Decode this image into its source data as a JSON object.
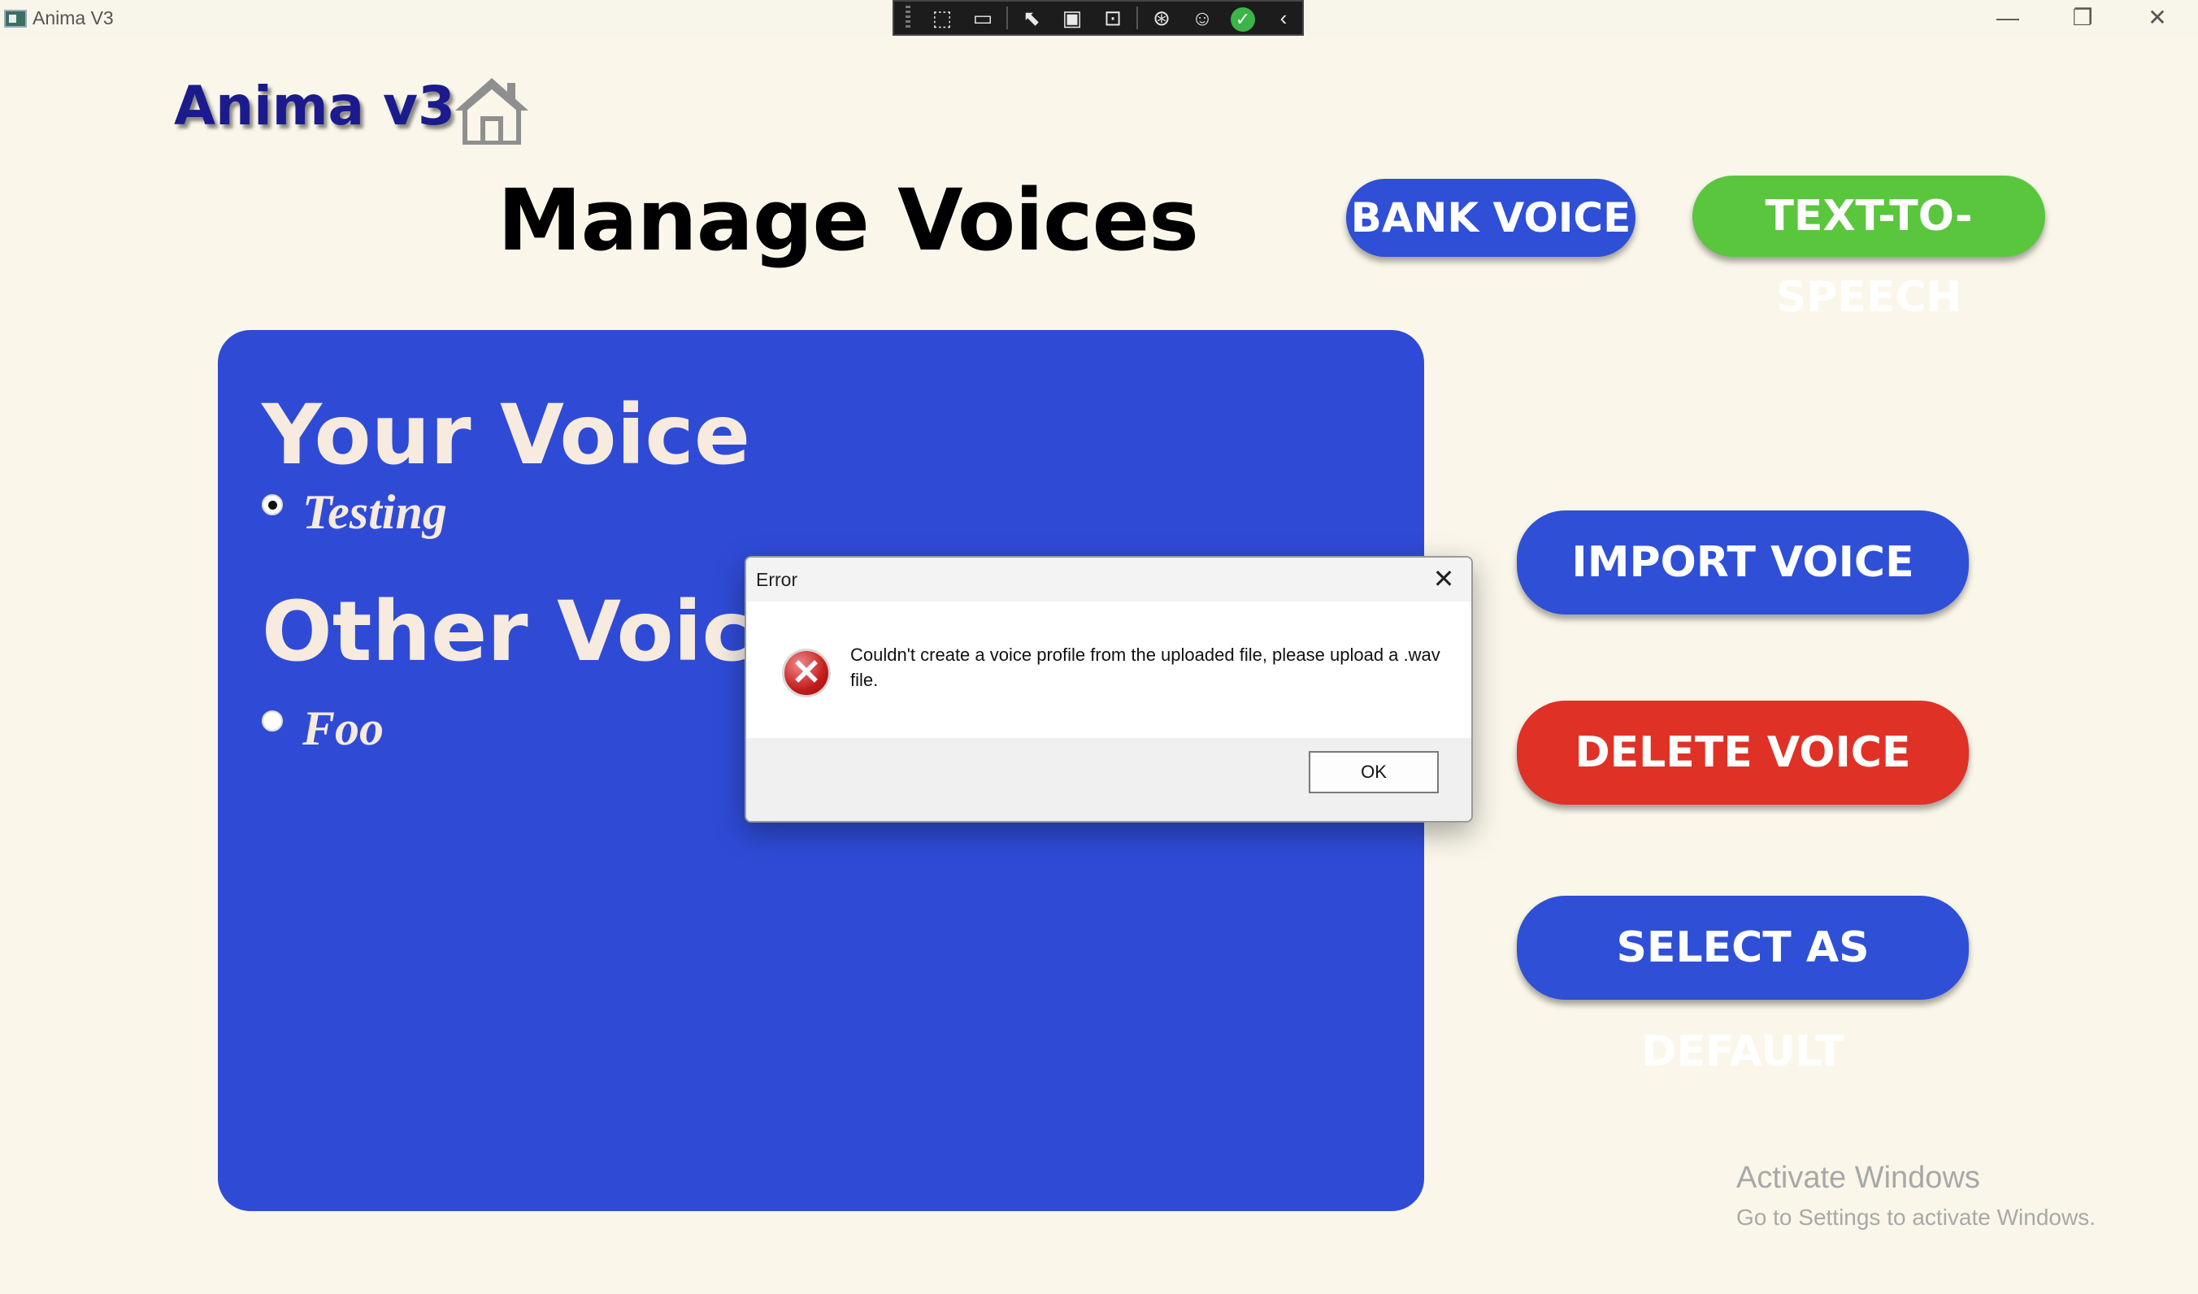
{
  "window": {
    "title": "Anima V3",
    "minimize": "—",
    "maximize": "❐",
    "close": "✕"
  },
  "devbar": {
    "icons": [
      "select-element-icon",
      "camera-icon",
      "pointer-icon",
      "frame-icon",
      "display-layout-icon",
      "track-focus-icon",
      "accessibility-icon",
      "check-icon",
      "collapse-icon"
    ]
  },
  "app": {
    "logo": "Anima v3",
    "page_title": "Manage Voices",
    "buttons": {
      "bank_voice": "BANK VOICE",
      "text_to_speech": "TEXT-TO-SPEECH",
      "import_voice": "IMPORT VOICE",
      "delete_voice": "DELETE VOICE",
      "select_default": "SELECT AS DEFAULT"
    },
    "colors": {
      "primary": "#2f4fd6",
      "green": "#5ac63d",
      "red": "#e03126",
      "background": "#faf7ea"
    }
  },
  "voices": {
    "your_voice_heading": "Your Voice",
    "your_voice": [
      {
        "name": "Testing",
        "selected": true
      }
    ],
    "other_voices_heading": "Other Voices",
    "other_voices": [
      {
        "name": "Foo",
        "selected": false
      }
    ]
  },
  "watermark": {
    "line1": "Activate Windows",
    "line2": "Go to Settings to activate Windows."
  },
  "dialog": {
    "title": "Error",
    "close": "✕",
    "message": "Couldn't create a voice profile from the uploaded file, please upload a .wav file.",
    "ok": "OK",
    "icon": "error-icon"
  }
}
